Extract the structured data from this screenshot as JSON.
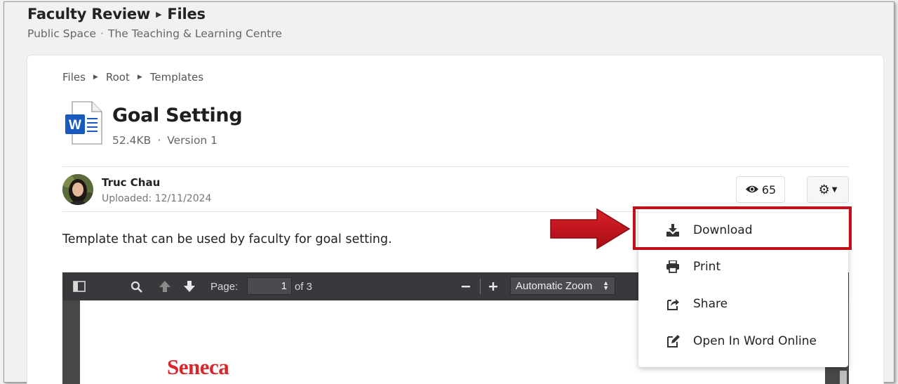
{
  "header": {
    "group": "Faculty Review",
    "section": "Files",
    "space_type": "Public Space",
    "space_name": "The Teaching & Learning Centre"
  },
  "breadcrumb": [
    "Files",
    "Root",
    "Templates"
  ],
  "file": {
    "title": "Goal Setting",
    "size": "52.4KB",
    "version": "Version 1",
    "icon": "word-document-icon",
    "icon_color": "#185abd"
  },
  "author": {
    "name": "Truc Chau",
    "uploaded": "Uploaded: 12/11/2024"
  },
  "views": "65",
  "description": "Template that can be used by faculty for goal setting.",
  "pdf_viewer": {
    "page_label": "Page:",
    "page_value": "1",
    "page_total": "of 3",
    "zoom": "Automatic Zoom",
    "doc_text": "Seneca",
    "doc_text_color": "#d6282c"
  },
  "menu": {
    "items": [
      {
        "label": "Download",
        "icon": "download-icon"
      },
      {
        "label": "Print",
        "icon": "print-icon"
      },
      {
        "label": "Share",
        "icon": "share-icon"
      },
      {
        "label": "Open In Word Online",
        "icon": "edit-icon"
      }
    ]
  },
  "annotation": {
    "highlight_color": "#c0101a"
  }
}
